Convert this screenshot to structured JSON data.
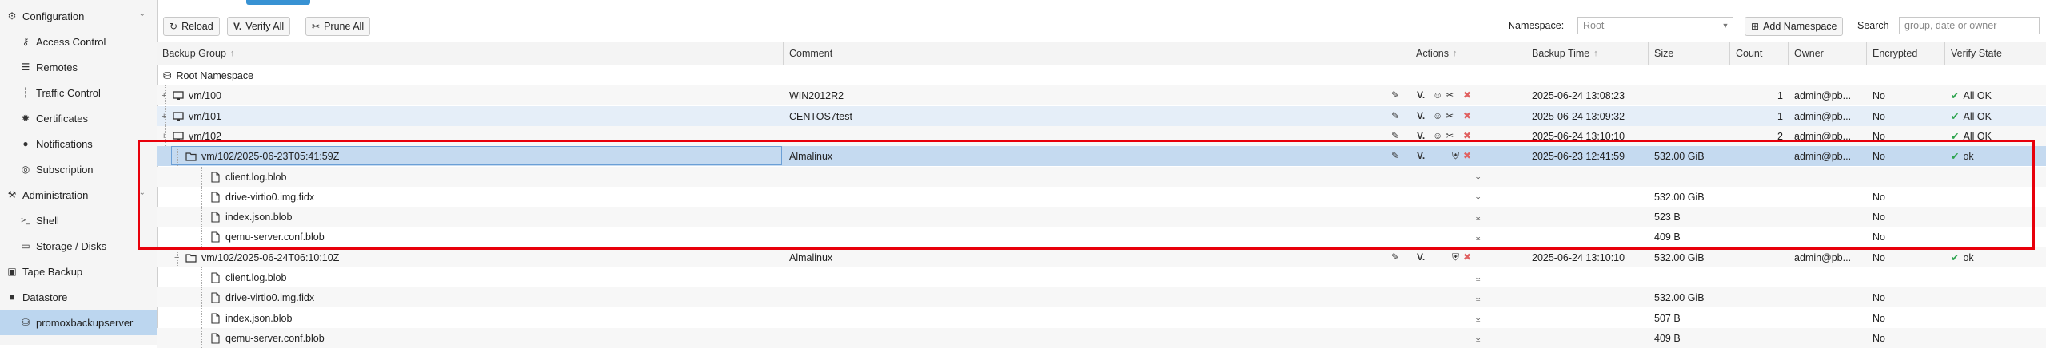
{
  "sidebar": {
    "items": [
      {
        "label": "Configuration",
        "icon": "gears-icon",
        "level": 0,
        "chevron": true
      },
      {
        "label": "Access Control",
        "icon": "key-icon",
        "level": 1
      },
      {
        "label": "Remotes",
        "icon": "server-icon",
        "level": 1
      },
      {
        "label": "Traffic Control",
        "icon": "bar-chart-icon",
        "level": 1
      },
      {
        "label": "Certificates",
        "icon": "certificate-icon",
        "level": 1
      },
      {
        "label": "Notifications",
        "icon": "bell-icon",
        "level": 1
      },
      {
        "label": "Subscription",
        "icon": "support-icon",
        "level": 1
      },
      {
        "label": "Administration",
        "icon": "wrench-icon",
        "level": 0,
        "chevron": true
      },
      {
        "label": "Shell",
        "icon": "terminal-icon",
        "level": 1
      },
      {
        "label": "Storage / Disks",
        "icon": "hdd-icon",
        "level": 1
      },
      {
        "label": "Tape Backup",
        "icon": "tape-icon",
        "level": 0
      },
      {
        "label": "Datastore",
        "icon": "archive-icon",
        "level": 0
      },
      {
        "label": "promoxbackupserver",
        "icon": "database-icon",
        "level": 1,
        "selected": true
      }
    ]
  },
  "toolbar": {
    "reload_label": "Reload",
    "verify_all_label": "Verify All",
    "prune_all_label": "Prune All",
    "namespace_label": "Namespace:",
    "namespace_value": "Root",
    "add_namespace_label": "Add Namespace",
    "search_label": "Search",
    "search_placeholder": "group, date or owner"
  },
  "grid": {
    "columns": [
      "Backup Group",
      "Comment",
      "Actions",
      "Backup Time",
      "Size",
      "Count",
      "Owner",
      "Encrypted",
      "Verify State"
    ],
    "root_label": "Root Namespace",
    "rows": [
      {
        "kind": "vm",
        "name": "vm/100",
        "comment": "WIN2012R2",
        "verify_label": "V.",
        "time": "2025-06-24 13:08:23",
        "size": "",
        "count": "1",
        "owner": "admin@pb...",
        "encrypted": "No",
        "verify": "All OK",
        "actions": "group"
      },
      {
        "kind": "vm",
        "name": "vm/101",
        "comment": "CENTOS7test",
        "verify_label": "V.",
        "time": "2025-06-24 13:09:32",
        "size": "",
        "count": "1",
        "owner": "admin@pb...",
        "encrypted": "No",
        "verify": "All OK",
        "actions": "group"
      },
      {
        "kind": "vm",
        "name": "vm/102",
        "comment": "",
        "verify_label": "V.",
        "time": "2025-06-24 13:10:10",
        "size": "",
        "count": "2",
        "owner": "admin@pb...",
        "encrypted": "No",
        "verify": "All OK",
        "actions": "group"
      },
      {
        "kind": "snapshot",
        "name": "vm/102/2025-06-23T05:41:59Z",
        "comment": "Almalinux",
        "verify_label": "V.",
        "time": "2025-06-23 12:41:59",
        "size": "532.00 GiB",
        "count": "",
        "owner": "admin@pb...",
        "encrypted": "No",
        "verify": "ok",
        "actions": "snapshot"
      },
      {
        "kind": "file",
        "name": "client.log.blob",
        "comment": "",
        "time": "",
        "size": "",
        "count": "",
        "owner": "",
        "encrypted": "",
        "verify": "",
        "actions": "file"
      },
      {
        "kind": "file",
        "name": "drive-virtio0.img.fidx",
        "comment": "",
        "time": "",
        "size": "532.00 GiB",
        "count": "",
        "owner": "",
        "encrypted": "No",
        "verify": "",
        "actions": "file"
      },
      {
        "kind": "file",
        "name": "index.json.blob",
        "comment": "",
        "time": "",
        "size": "523 B",
        "count": "",
        "owner": "",
        "encrypted": "No",
        "verify": "",
        "actions": "file"
      },
      {
        "kind": "file",
        "name": "qemu-server.conf.blob",
        "comment": "",
        "time": "",
        "size": "409 B",
        "count": "",
        "owner": "",
        "encrypted": "No",
        "verify": "",
        "actions": "file"
      },
      {
        "kind": "snapshot",
        "name": "vm/102/2025-06-24T06:10:10Z",
        "comment": "Almalinux",
        "verify_label": "V.",
        "time": "2025-06-24 13:10:10",
        "size": "532.00 GiB",
        "count": "",
        "owner": "admin@pb...",
        "encrypted": "No",
        "verify": "ok",
        "actions": "snapshot"
      },
      {
        "kind": "file",
        "name": "client.log.blob",
        "comment": "",
        "time": "",
        "size": "",
        "count": "",
        "owner": "",
        "encrypted": "",
        "verify": "",
        "actions": "file"
      },
      {
        "kind": "file",
        "name": "drive-virtio0.img.fidx",
        "comment": "",
        "time": "",
        "size": "532.00 GiB",
        "count": "",
        "owner": "",
        "encrypted": "No",
        "verify": "",
        "actions": "file"
      },
      {
        "kind": "file",
        "name": "index.json.blob",
        "comment": "",
        "time": "",
        "size": "507 B",
        "count": "",
        "owner": "",
        "encrypted": "No",
        "verify": "",
        "actions": "file"
      },
      {
        "kind": "file",
        "name": "qemu-server.conf.blob",
        "comment": "",
        "time": "",
        "size": "409 B",
        "count": "",
        "owner": "",
        "encrypted": "No",
        "verify": "",
        "actions": "file"
      }
    ]
  },
  "colors": {
    "accent": "#3892d3",
    "selected_row": "#c5daf0",
    "ok_green": "#2ea44f",
    "delete_red": "#e06060",
    "annotation_red": "#e8000b"
  }
}
